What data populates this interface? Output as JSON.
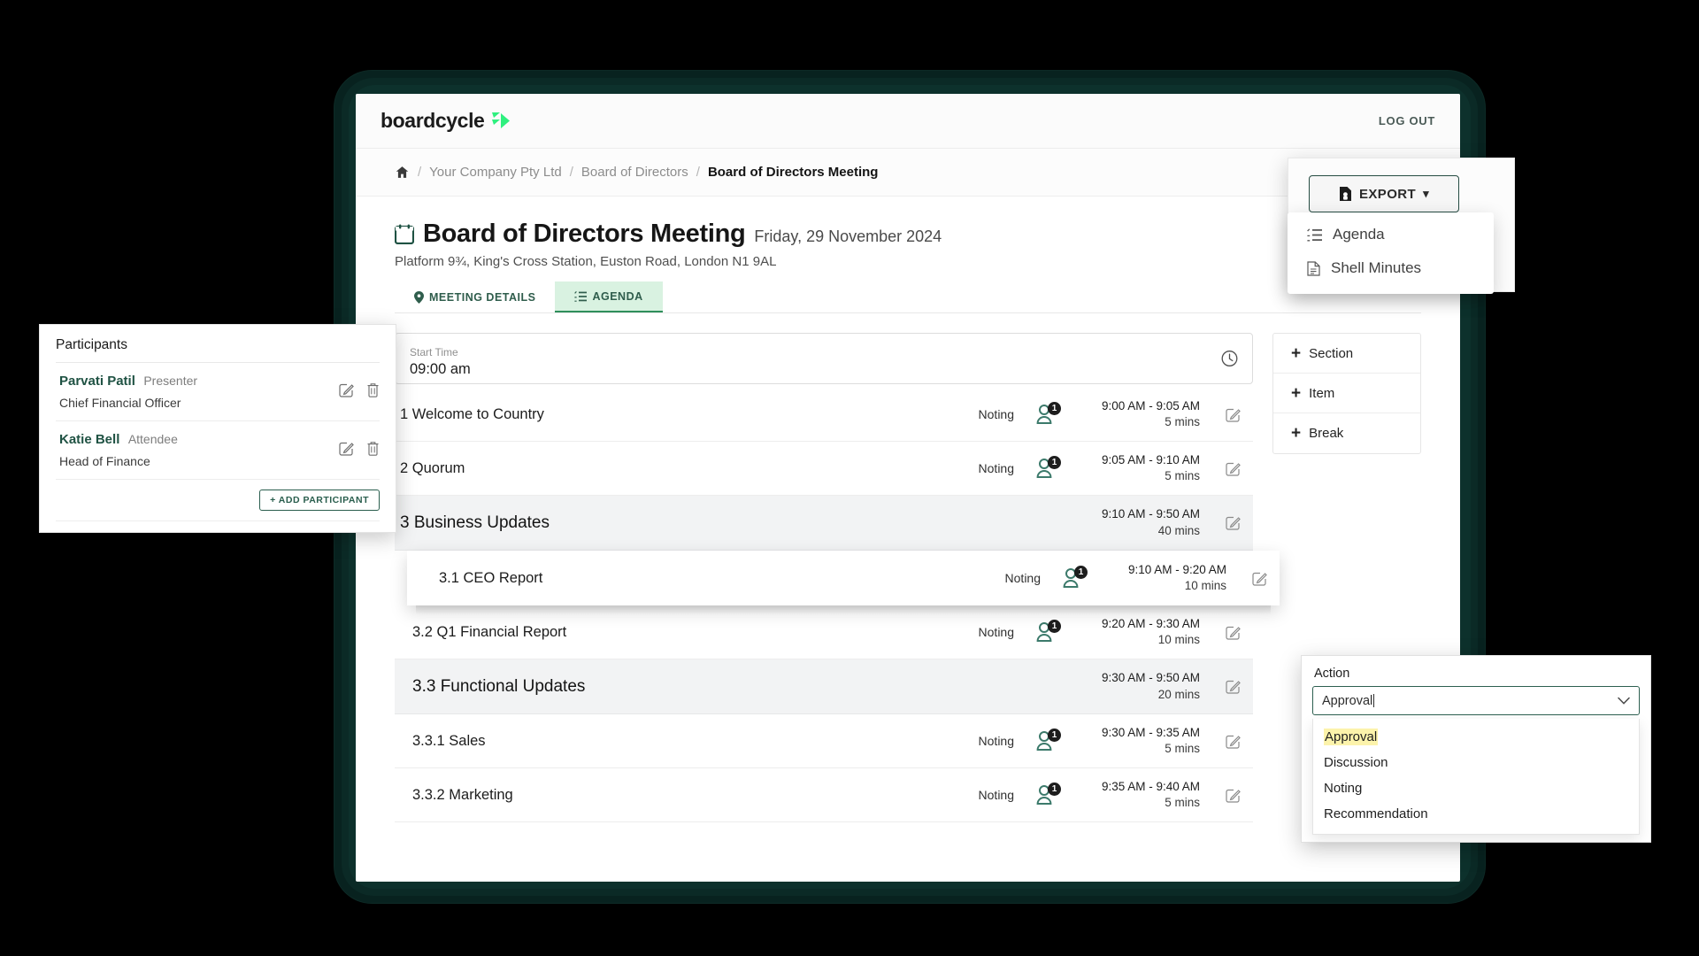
{
  "header": {
    "logo_text": "boardcycle",
    "logo_icon": "boardcycle-play-mark",
    "logout_label": "LOG OUT"
  },
  "breadcrumb": {
    "home_icon": "home-icon",
    "sep": "/",
    "items": [
      {
        "label": "Your Company Pty Ltd",
        "active": false
      },
      {
        "label": "Board of Directors",
        "active": false
      },
      {
        "label": "Board of Directors Meeting",
        "active": true
      }
    ]
  },
  "meeting": {
    "calendar_icon": "calendar-icon",
    "title": "Board of Directors Meeting",
    "date": "Friday, 29 November 2024",
    "location": "Platform 9¾, King's Cross Station, Euston Road, London N1 9AL"
  },
  "tabs": [
    {
      "label": "MEETING DETAILS",
      "icon": "map-pin-icon",
      "active": false
    },
    {
      "label": "AGENDA",
      "icon": "list-ordered-icon",
      "active": true
    }
  ],
  "start_time": {
    "label": "Start Time",
    "value": "09:00 am",
    "icon": "clock-icon"
  },
  "side_buttons": [
    {
      "label": "Section",
      "plus": "+"
    },
    {
      "label": "Item",
      "plus": "+"
    },
    {
      "label": "Break",
      "plus": "+"
    }
  ],
  "agenda_rows": [
    {
      "number": "1",
      "title": "1 Welcome to Country",
      "type": "Noting",
      "people": "1",
      "time": "9:00 AM - 9:05 AM",
      "duration": "5 mins",
      "kind": "item",
      "indent": 0,
      "edit_icon": "edit-icon"
    },
    {
      "number": "2",
      "title": "2 Quorum",
      "type": "Noting",
      "people": "1",
      "time": "9:05 AM - 9:10 AM",
      "duration": "5 mins",
      "kind": "item",
      "indent": 0,
      "edit_icon": "edit-icon"
    },
    {
      "number": "3",
      "title": "3 Business Updates",
      "type": "",
      "people": "",
      "time": "9:10 AM - 9:50 AM",
      "duration": "40 mins",
      "kind": "section",
      "indent": 0,
      "edit_icon": "edit-icon"
    },
    {
      "number": "3.1",
      "title": "3.1 CEO Report",
      "type": "Noting",
      "people": "1",
      "time": "9:10 AM - 9:20 AM",
      "duration": "10 mins",
      "kind": "dragging",
      "indent": 1,
      "edit_icon": "edit-icon"
    },
    {
      "number": "3.2",
      "title": "3.2 Q1 Financial Report",
      "type": "Noting",
      "people": "1",
      "time": "9:20 AM - 9:30 AM",
      "duration": "10 mins",
      "kind": "item",
      "indent": 1,
      "edit_icon": "edit-icon"
    },
    {
      "number": "3.3",
      "title": "3.3 Functional Updates",
      "type": "",
      "people": "",
      "time": "9:30 AM - 9:50 AM",
      "duration": "20 mins",
      "kind": "section",
      "indent": 1,
      "edit_icon": "edit-icon"
    },
    {
      "number": "3.3.1",
      "title": "3.3.1 Sales",
      "type": "Noting",
      "people": "1",
      "time": "9:30 AM - 9:35 AM",
      "duration": "5 mins",
      "kind": "item",
      "indent": 2,
      "edit_icon": "edit-icon"
    },
    {
      "number": "3.3.2",
      "title": "3.3.2 Marketing",
      "type": "Noting",
      "people": "1",
      "time": "9:35 AM - 9:40 AM",
      "duration": "5 mins",
      "kind": "item",
      "indent": 2,
      "edit_icon": "edit-icon"
    }
  ],
  "participants_panel": {
    "heading": "Participants",
    "add_label": "+ ADD PARTICIPANT",
    "people": [
      {
        "name": "Parvati Patil",
        "role": "Presenter",
        "title": "Chief Financial Officer",
        "edit_icon": "edit-icon",
        "delete_icon": "trash-icon"
      },
      {
        "name": "Katie Bell",
        "role": "Attendee",
        "title": "Head of Finance",
        "edit_icon": "edit-icon",
        "delete_icon": "trash-icon"
      }
    ]
  },
  "export": {
    "button_label": "EXPORT",
    "button_icon": "file-export-icon",
    "caret": "▾",
    "menu": [
      {
        "label": "Agenda",
        "icon": "list-ordered-icon"
      },
      {
        "label": "Shell Minutes",
        "icon": "document-icon"
      }
    ]
  },
  "action_dropdown": {
    "label": "Action",
    "value": "Approval",
    "chevron_icon": "chevron-down-icon",
    "options": [
      {
        "label": "Approval",
        "highlighted": true
      },
      {
        "label": "Discussion",
        "highlighted": false
      },
      {
        "label": "Noting",
        "highlighted": false
      },
      {
        "label": "Recommendation",
        "highlighted": false
      }
    ]
  },
  "colors": {
    "brand_green": "#2ff07f",
    "dark_teal": "#0b2a26",
    "accent_green": "#2f8f5b",
    "tab_active_bg": "#d9f2e1",
    "highlight_yellow": "#fcf3ab",
    "person_icon": "#3c7a6b"
  }
}
